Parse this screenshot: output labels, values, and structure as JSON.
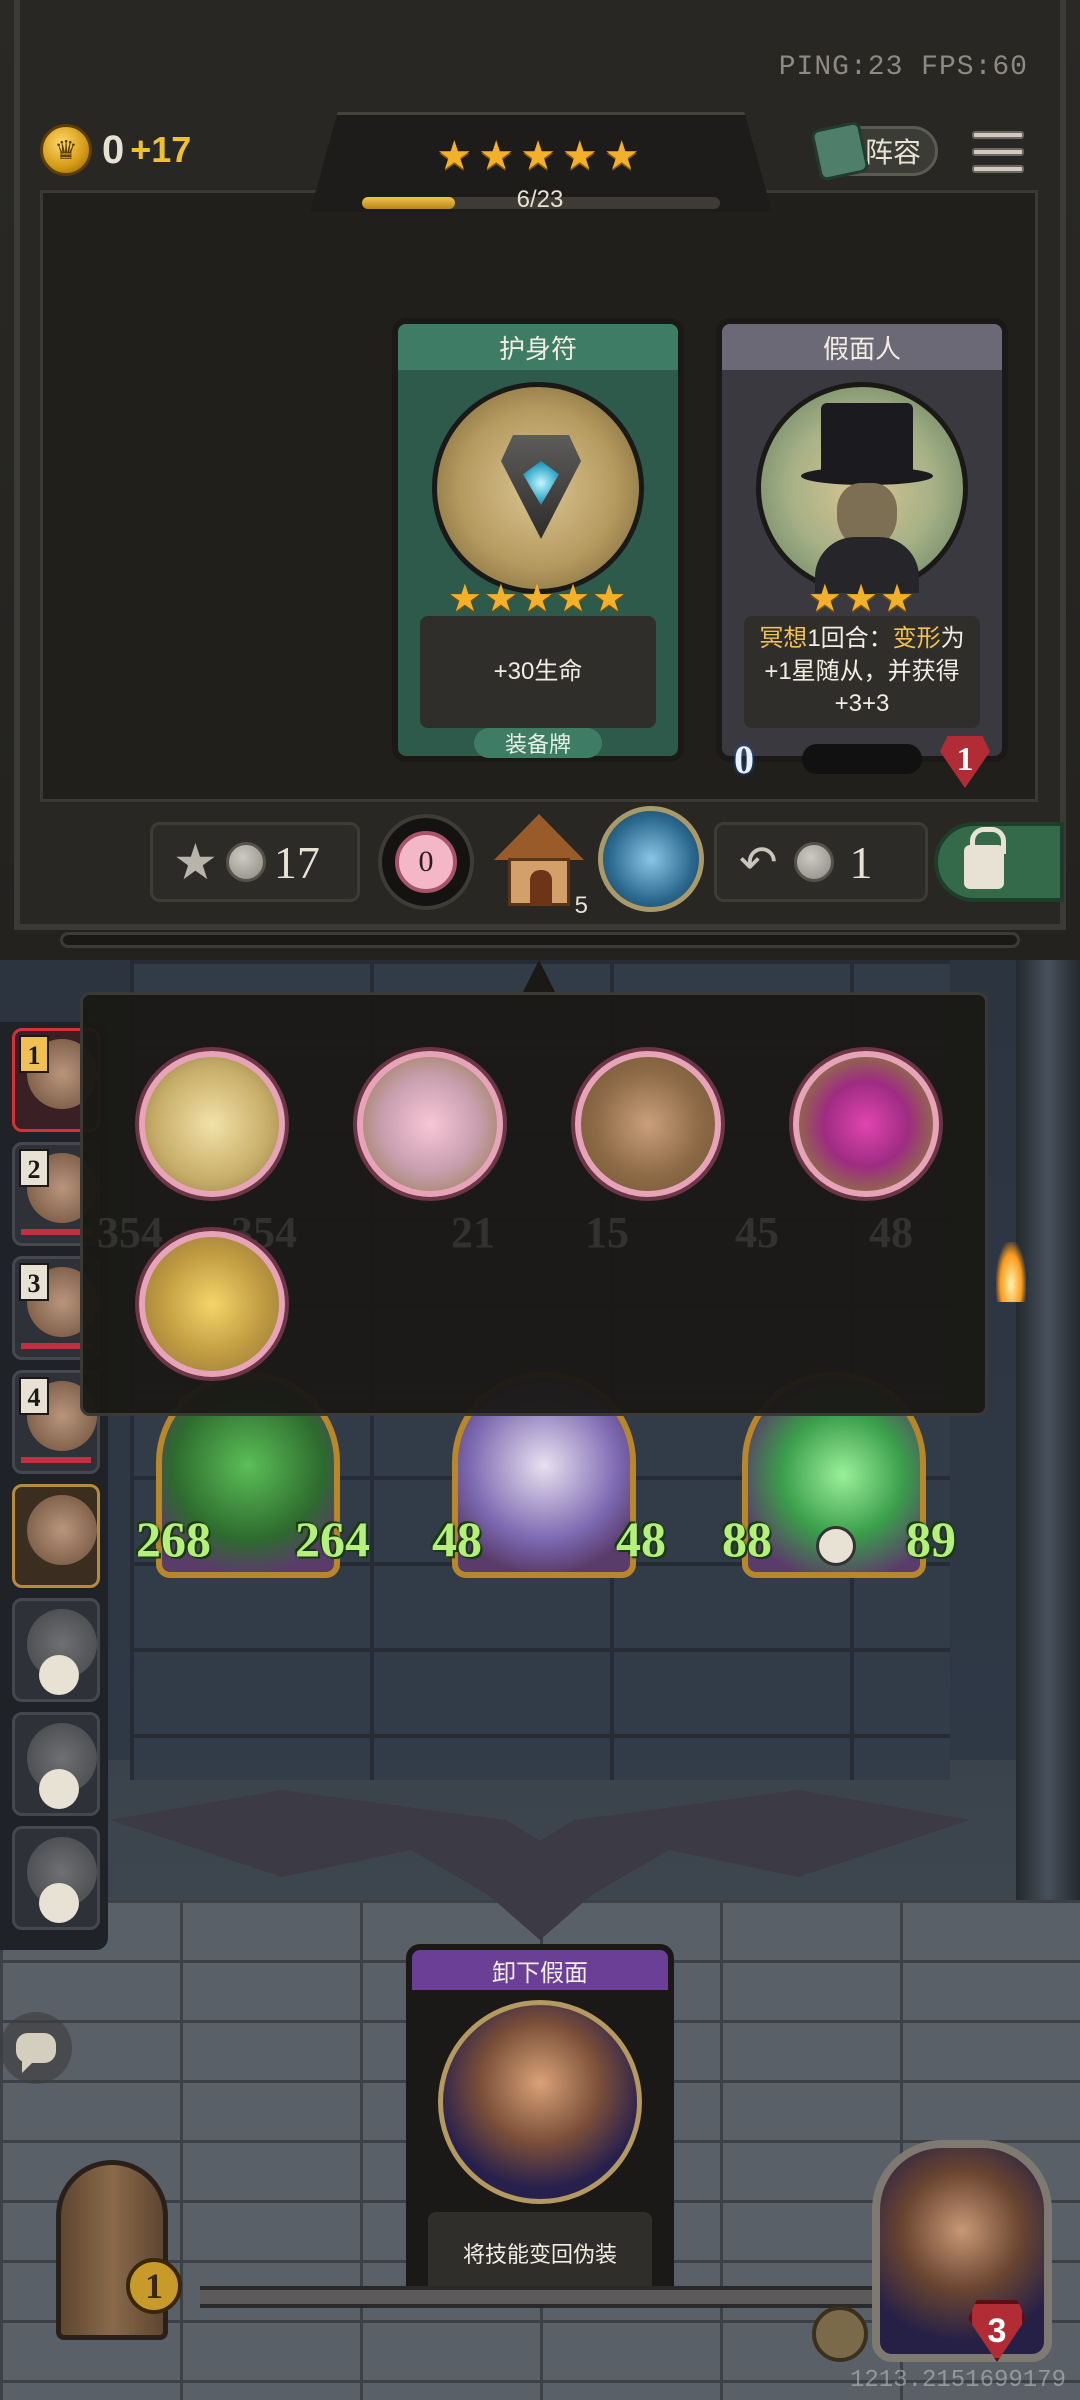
{
  "status": {
    "ping_fps": "PING:23   FPS:60"
  },
  "resources": {
    "gold": "0",
    "income": "+17"
  },
  "tavern_tier": {
    "stars": "★★★★★",
    "progress_text": "6/23",
    "progress_fraction": 0.26
  },
  "header": {
    "lineup_label": "阵容"
  },
  "shop": {
    "cards": [
      {
        "name": "护身符",
        "stars": "★★★★★",
        "description": "+30生命",
        "type_label": "装备牌"
      },
      {
        "name": "假面人",
        "stars": "★★★",
        "desc_highlight_1": "冥想",
        "desc_part_1": "1回合：",
        "desc_highlight_2": "变形",
        "desc_part_2": "为",
        "desc_line_2": "+1星随从，并获得+3+3",
        "attack": "0",
        "health": "1"
      }
    ]
  },
  "actions": {
    "upgrade_cost": "17",
    "flower_count": "0",
    "house_count": "5",
    "refresh_cost": "1"
  },
  "turn_order": [
    {
      "rank": "1",
      "state": "active"
    },
    {
      "rank": "2",
      "state": "alive"
    },
    {
      "rank": "3",
      "state": "alive"
    },
    {
      "rank": "4",
      "state": "alive"
    },
    {
      "rank": "",
      "state": "player"
    },
    {
      "rank": "",
      "state": "dead"
    },
    {
      "rank": "",
      "state": "dead"
    },
    {
      "rank": "",
      "state": "dead"
    }
  ],
  "board_ghost_stats": [
    "354",
    "354",
    "21",
    "15",
    "45",
    "48"
  ],
  "board": [
    {
      "attack": "268",
      "health": "264",
      "dead": false
    },
    {
      "attack": "48",
      "health": "48",
      "dead": false
    },
    {
      "attack": "88",
      "health": "89",
      "dead": true
    }
  ],
  "discover_icons": [
    "candy-icon",
    "gumball-machine-icon",
    "dragon-egg-icon",
    "splash-icon",
    "golden-nuts-icon"
  ],
  "hand_card": {
    "name": "卸下假面",
    "description": "将技能变回伪装"
  },
  "tavern_badge": "1",
  "hero": {
    "health": "3"
  },
  "seed_text": "1213.2151699179"
}
